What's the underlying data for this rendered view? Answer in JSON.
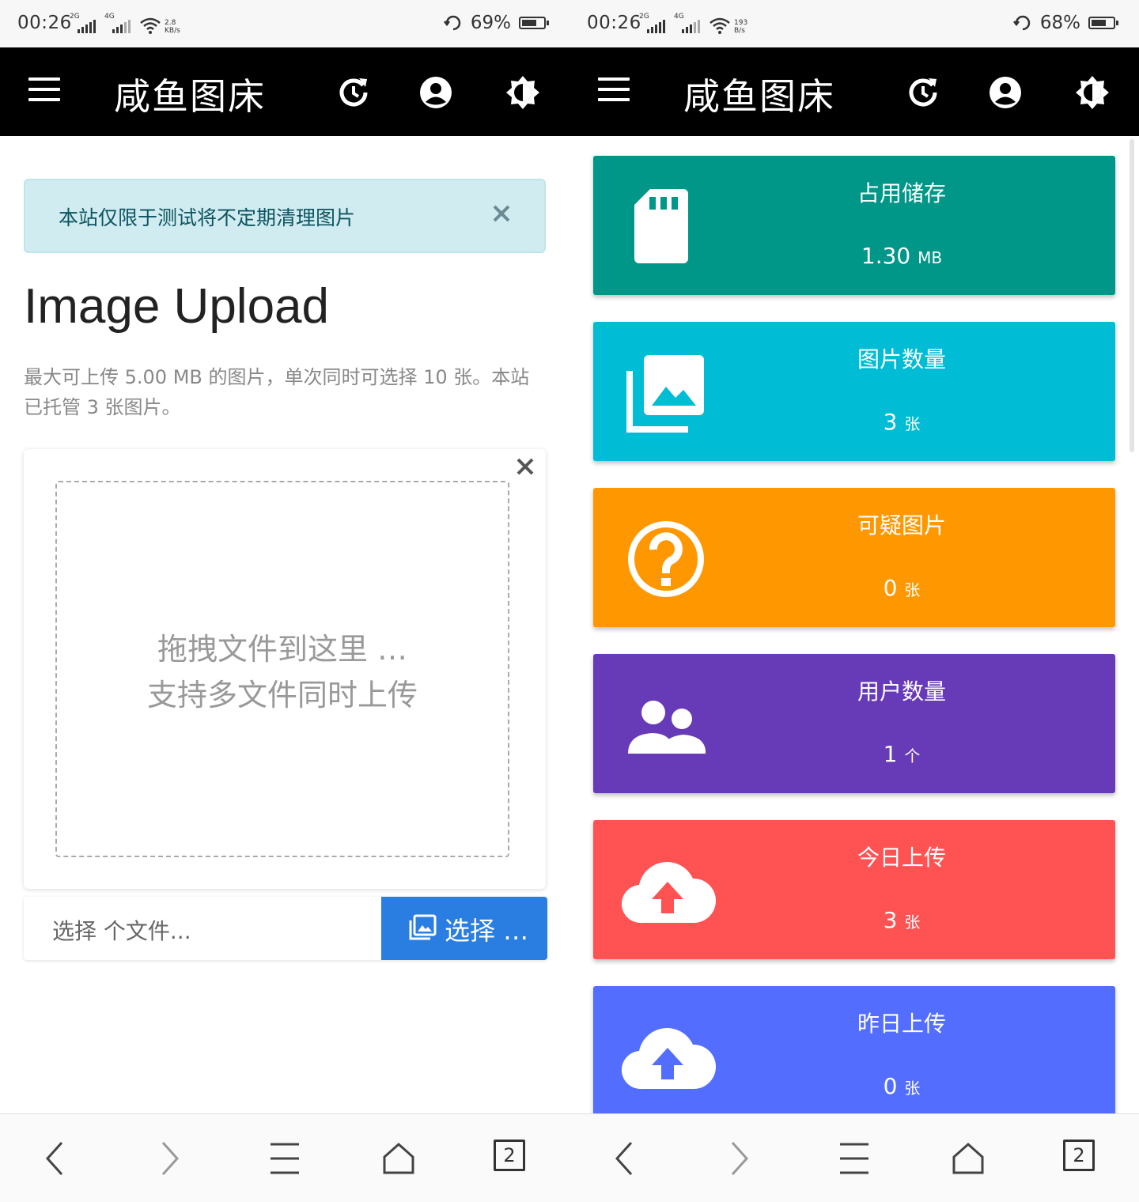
{
  "left": {
    "status": {
      "time": "00:26",
      "net1": "2G",
      "net2": "4G",
      "speed_top": "2.8",
      "speed_bottom": "KB/s",
      "battery": "69%",
      "battery_level": 0.69
    },
    "appbar": {
      "title": "咸鱼图床"
    },
    "alert": {
      "text": "本站仅限于测试将不定期清理图片"
    },
    "heading": "Image Upload",
    "description": "最大可上传 5.00 MB 的图片，单次同时可选择 10 张。本站已托管 3 张图片。",
    "dropzone": {
      "line1": "拖拽文件到这里 …",
      "line2": "支持多文件同时上传"
    },
    "file_input": {
      "placeholder": "选择 个文件...",
      "button": "选择 …"
    },
    "nav": {
      "tabs": "2"
    }
  },
  "right": {
    "status": {
      "time": "00:26",
      "net1": "2G",
      "net2": "4G",
      "speed_top": "193",
      "speed_bottom": "B/s",
      "battery": "68%",
      "battery_level": 0.68
    },
    "appbar": {
      "title": "咸鱼图床"
    },
    "stats": [
      {
        "label": "占用储存",
        "value": "1.30",
        "unit": "MB",
        "color": "#009688",
        "icon": "sd-card-icon"
      },
      {
        "label": "图片数量",
        "value": "3",
        "unit": "张",
        "color": "#00bcd4",
        "icon": "photo-library-icon"
      },
      {
        "label": "可疑图片",
        "value": "0",
        "unit": "张",
        "color": "#ff9800",
        "icon": "help-circle-icon"
      },
      {
        "label": "用户数量",
        "value": "1",
        "unit": "个",
        "color": "#673ab7",
        "icon": "people-icon"
      },
      {
        "label": "今日上传",
        "value": "3",
        "unit": "张",
        "color": "#ff5252",
        "icon": "cloud-upload-icon"
      },
      {
        "label": "昨日上传",
        "value": "0",
        "unit": "张",
        "color": "#536dfe",
        "icon": "cloud-upload-icon"
      }
    ],
    "nav": {
      "tabs": "2"
    }
  }
}
